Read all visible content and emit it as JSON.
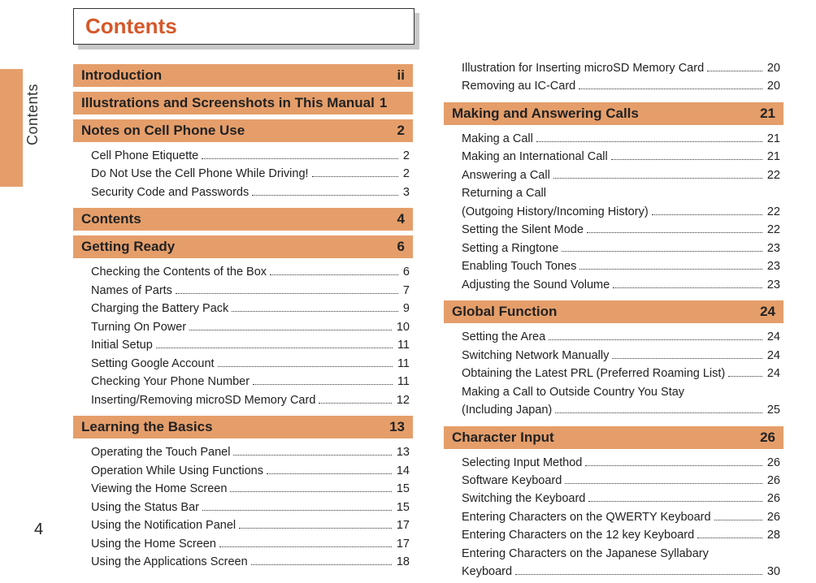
{
  "pageTitle": "Contents",
  "sideLabel": "Contents",
  "pageNumber": "4",
  "columns": [
    {
      "sections": [
        {
          "title": "Introduction",
          "page": "ii",
          "items": []
        },
        {
          "title": "Illustrations and Screenshots in This Manual",
          "page": "1",
          "tight": true,
          "items": []
        },
        {
          "title": "Notes on Cell Phone Use",
          "page": "2",
          "items": [
            {
              "label": "Cell Phone Etiquette",
              "page": "2"
            },
            {
              "label": "Do Not Use the Cell Phone While Driving!",
              "page": "2"
            },
            {
              "label": "Security Code and Passwords",
              "page": "3"
            }
          ]
        },
        {
          "title": "Contents",
          "page": "4",
          "items": []
        },
        {
          "title": "Getting Ready",
          "page": "6",
          "items": [
            {
              "label": "Checking the Contents of the Box",
              "page": "6"
            },
            {
              "label": "Names of Parts",
              "page": "7"
            },
            {
              "label": "Charging the Battery Pack",
              "page": "9"
            },
            {
              "label": "Turning On Power",
              "page": "10"
            },
            {
              "label": "Initial Setup",
              "page": "11"
            },
            {
              "label": "Setting Google Account",
              "page": "11"
            },
            {
              "label": "Checking Your Phone Number",
              "page": "11"
            },
            {
              "label": "Inserting/Removing microSD Memory Card",
              "page": "12"
            }
          ]
        },
        {
          "title": "Learning the Basics",
          "page": "13",
          "items": [
            {
              "label": "Operating the Touch Panel",
              "page": "13"
            },
            {
              "label": "Operation While Using Functions",
              "page": "14"
            },
            {
              "label": "Viewing the Home Screen",
              "page": "15"
            },
            {
              "label": "Using the Status Bar",
              "page": "15"
            },
            {
              "label": "Using the Notification Panel",
              "page": "17"
            },
            {
              "label": "Using the Home Screen",
              "page": "17"
            },
            {
              "label": "Using the Applications Screen",
              "page": "18"
            }
          ]
        }
      ]
    },
    {
      "sections": [
        {
          "preItems": [
            {
              "label": "Illustration for Inserting microSD Memory Card",
              "page": "20"
            },
            {
              "label": "Removing au IC-Card",
              "page": "20"
            }
          ]
        },
        {
          "title": "Making and Answering Calls",
          "page": "21",
          "items": [
            {
              "label": "Making a Call",
              "page": "21"
            },
            {
              "label": "Making an International Call",
              "page": "21"
            },
            {
              "label": "Answering a Call",
              "page": "22"
            },
            {
              "label": "Returning a Call",
              "cont": true
            },
            {
              "label": "(Outgoing History/Incoming History)",
              "page": "22"
            },
            {
              "label": "Setting the Silent Mode",
              "page": "22"
            },
            {
              "label": "Setting a Ringtone",
              "page": "23"
            },
            {
              "label": "Enabling Touch Tones",
              "page": "23"
            },
            {
              "label": "Adjusting the Sound Volume",
              "page": "23"
            }
          ]
        },
        {
          "title": "Global Function",
          "page": "24",
          "items": [
            {
              "label": "Setting the Area",
              "page": "24"
            },
            {
              "label": "Switching Network Manually",
              "page": "24"
            },
            {
              "label": "Obtaining the Latest PRL (Preferred Roaming List)",
              "page": "24"
            },
            {
              "label": "Making a Call to Outside Country You Stay",
              "cont": true
            },
            {
              "label": "(Including Japan)",
              "page": "25"
            }
          ]
        },
        {
          "title": "Character Input",
          "page": "26",
          "items": [
            {
              "label": "Selecting Input Method",
              "page": "26"
            },
            {
              "label": "Software Keyboard",
              "page": "26"
            },
            {
              "label": "Switching the Keyboard",
              "page": "26"
            },
            {
              "label": "Entering Characters on the QWERTY Keyboard",
              "page": "26"
            },
            {
              "label": "Entering Characters on the 12 key Keyboard",
              "page": "28"
            },
            {
              "label": "Entering Characters on the Japanese Syllabary",
              "cont": true
            },
            {
              "label": "Keyboard",
              "page": "30"
            }
          ]
        }
      ]
    }
  ]
}
